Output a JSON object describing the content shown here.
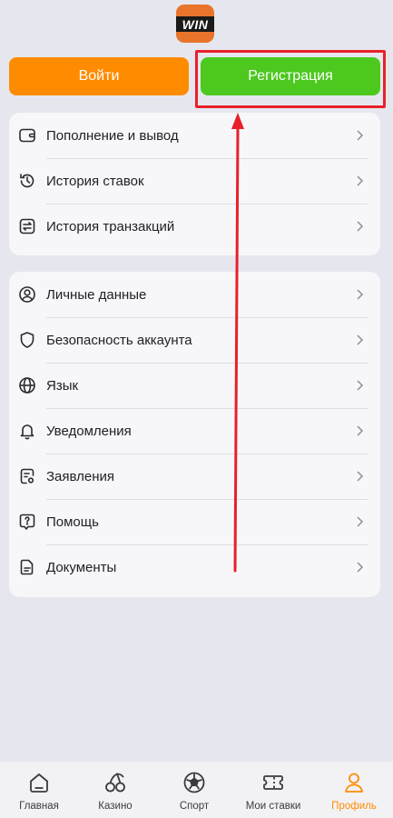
{
  "logo": {
    "text": "WIN"
  },
  "auth": {
    "login_label": "Войти",
    "register_label": "Регистрация"
  },
  "menu_group_1": [
    {
      "label": "Пополнение и вывод",
      "icon": "wallet-icon"
    },
    {
      "label": "История ставок",
      "icon": "history-icon"
    },
    {
      "label": "История транзакций",
      "icon": "transactions-icon"
    }
  ],
  "menu_group_2": [
    {
      "label": "Личные данные",
      "icon": "user-circle-icon"
    },
    {
      "label": "Безопасность аккаунта",
      "icon": "shield-icon"
    },
    {
      "label": "Язык",
      "icon": "globe-icon"
    },
    {
      "label": "Уведомления",
      "icon": "bell-icon"
    },
    {
      "label": "Заявления",
      "icon": "statements-icon"
    },
    {
      "label": "Помощь",
      "icon": "help-icon"
    },
    {
      "label": "Документы",
      "icon": "document-icon"
    }
  ],
  "tabbar": [
    {
      "label": "Главная",
      "icon": "home-icon"
    },
    {
      "label": "Казино",
      "icon": "cherry-icon"
    },
    {
      "label": "Спорт",
      "icon": "soccer-ball-icon"
    },
    {
      "label": "Мои ставки",
      "icon": "ticket-icon"
    },
    {
      "label": "Профиль",
      "icon": "profile-icon",
      "active": true
    }
  ],
  "colors": {
    "login": "#ff8c00",
    "register": "#4cc81f",
    "annotation": "#e8202a",
    "active_tab": "#ff8c00",
    "background": "#e6e7ee"
  }
}
